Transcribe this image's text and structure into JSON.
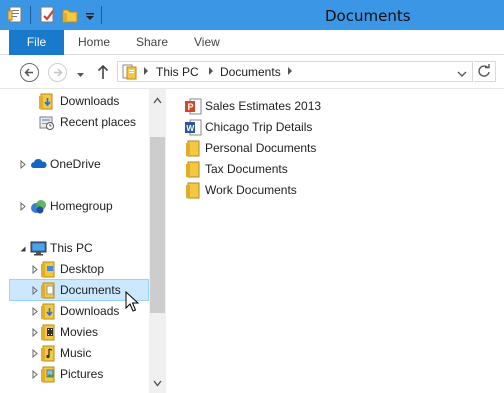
{
  "window": {
    "title": "Documents"
  },
  "ribbon": {
    "tabs": [
      {
        "label": "File"
      },
      {
        "label": "Home"
      },
      {
        "label": "Share"
      },
      {
        "label": "View"
      }
    ]
  },
  "address": {
    "crumbs": [
      "This PC",
      "Documents"
    ]
  },
  "navpane": {
    "items": [
      {
        "label": "Downloads",
        "icon": "downloads-folder-icon"
      },
      {
        "label": "Recent places",
        "icon": "recent-places-icon"
      },
      {
        "label": "OneDrive",
        "icon": "onedrive-cloud-icon"
      },
      {
        "label": "Homegroup",
        "icon": "homegroup-icon"
      },
      {
        "label": "This PC",
        "icon": "computer-icon"
      },
      {
        "label": "Desktop",
        "icon": "desktop-folder-icon"
      },
      {
        "label": "Documents",
        "icon": "documents-folder-icon",
        "selected": true
      },
      {
        "label": "Downloads",
        "icon": "downloads-folder-icon"
      },
      {
        "label": "Movies",
        "icon": "movies-folder-icon"
      },
      {
        "label": "Music",
        "icon": "music-folder-icon"
      },
      {
        "label": "Pictures",
        "icon": "pictures-folder-icon"
      }
    ]
  },
  "content": {
    "files": [
      {
        "name": "Sales Estimates 2013",
        "type": "powerpoint",
        "icon": "powerpoint-file-icon"
      },
      {
        "name": "Chicago Trip Details",
        "type": "word",
        "icon": "word-file-icon"
      },
      {
        "name": "Personal Documents",
        "type": "folder",
        "icon": "folder-icon"
      },
      {
        "name": "Tax Documents",
        "type": "folder",
        "icon": "folder-icon"
      },
      {
        "name": "Work Documents",
        "type": "folder",
        "icon": "folder-icon"
      }
    ]
  },
  "colors": {
    "titlebar": "#3c96e6",
    "file_tab": "#1979ca",
    "selection": "#cce8ff",
    "selection_border": "#99d1ff",
    "folder": "#f5c842"
  }
}
